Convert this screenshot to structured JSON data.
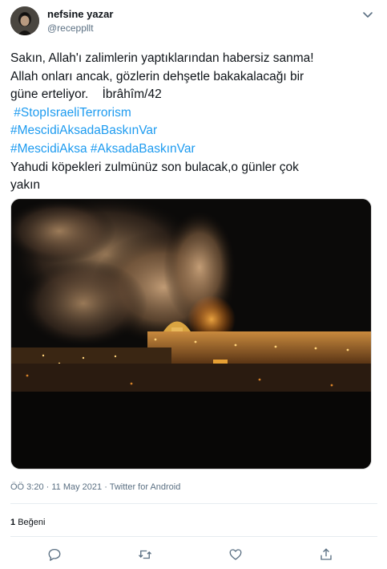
{
  "user": {
    "display_name": "nefsine yazar",
    "handle": "@receppllt"
  },
  "tweet": {
    "lines": [
      "Sakın, Allah'ı zalimlerin yaptıklarından habersiz sanma!",
      "Allah onları ancak, gözlerin dehşetle bakakalacağı bir",
      "güne erteliyor.    İbrâhîm/42"
    ],
    "hashtag_lines": [
      " #StopIsraeliTerrorism",
      "#MescidiAksadaBaskınVar",
      "#MescidiAksa #AksadaBaskınVar"
    ],
    "closing_lines": [
      "Yahudi köpekleri zulmünüz son bulacak,o günler çok",
      "yakın"
    ]
  },
  "meta": {
    "timestamp": "ÖÖ 3:20 · 11 May 2021 · Twitter for Android"
  },
  "engagement": {
    "like_count": "1",
    "like_label": "Beğeni"
  },
  "colors": {
    "link": "#1d9bf0",
    "secondary_text": "#5b7083",
    "divider": "#e6ecf0"
  },
  "icons": [
    "more-chevron-icon",
    "reply-icon",
    "retweet-icon",
    "like-icon",
    "share-icon"
  ]
}
